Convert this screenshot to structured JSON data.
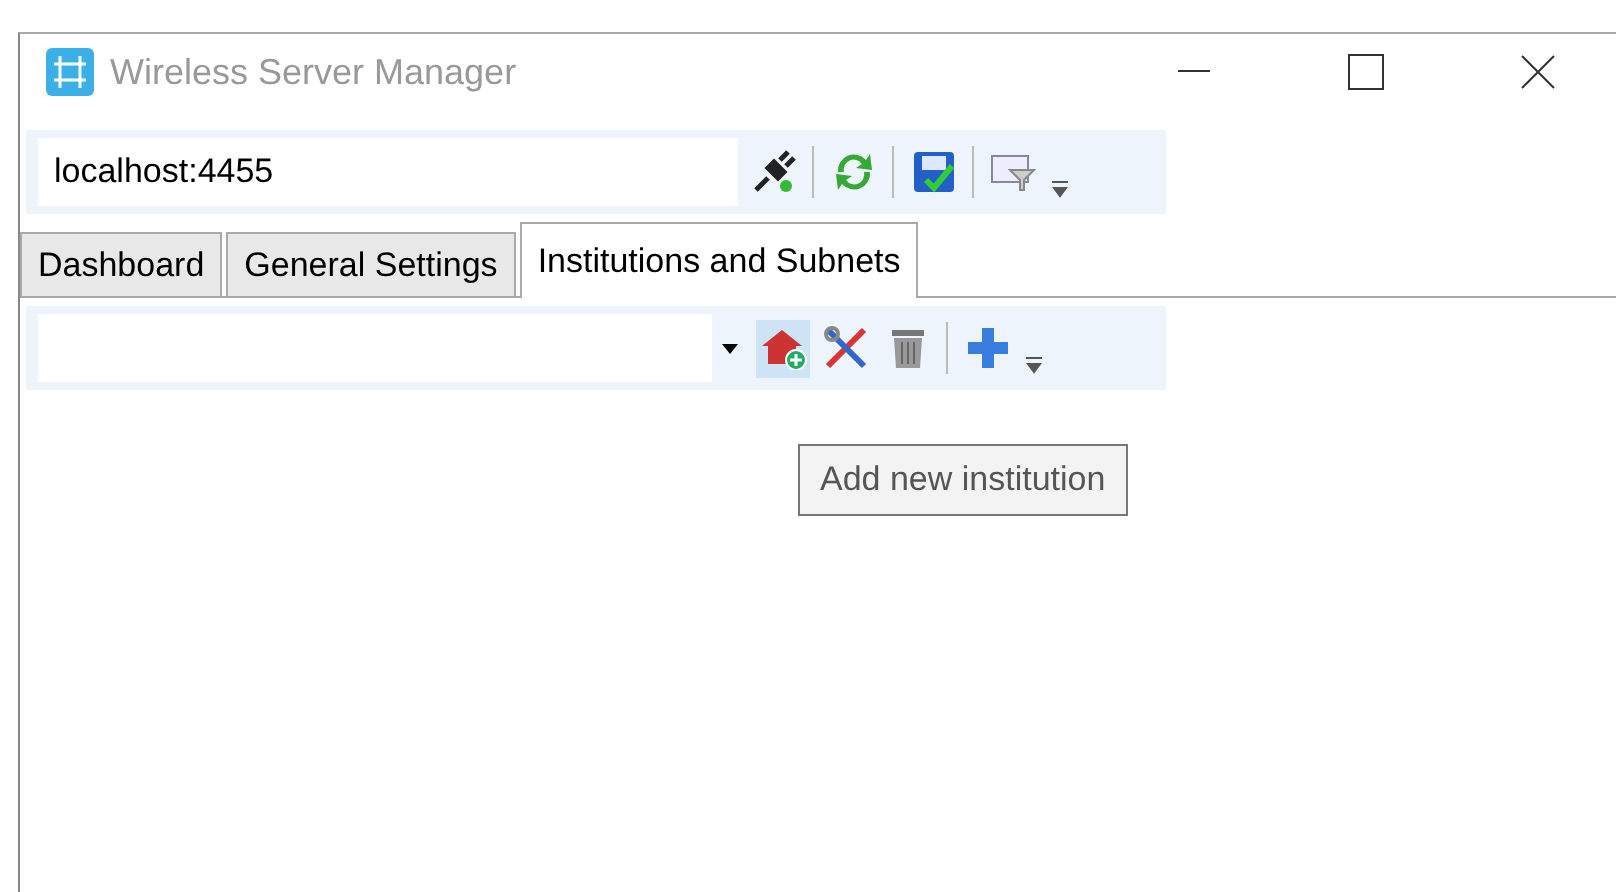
{
  "window": {
    "title": "Wireless Server Manager"
  },
  "server_toolbar": {
    "address": "localhost:4455",
    "buttons": [
      {
        "kind": "plug",
        "highlighted": false
      },
      {
        "kind": "refresh",
        "highlighted": false
      },
      {
        "kind": "save",
        "highlighted": false
      },
      {
        "kind": "filter",
        "highlighted": false
      }
    ]
  },
  "tabs": [
    {
      "label": "Dashboard",
      "selected": false
    },
    {
      "label": "General Settings",
      "selected": false
    },
    {
      "label": "Institutions and Subnets",
      "selected": true
    }
  ],
  "institution_toolbar": {
    "buttons": [
      {
        "kind": "add-institution",
        "highlighted": true
      },
      {
        "kind": "edit",
        "highlighted": false
      },
      {
        "kind": "delete",
        "highlighted": false
      },
      {
        "kind": "add",
        "highlighted": false
      }
    ]
  },
  "tooltip": "Add new institution"
}
